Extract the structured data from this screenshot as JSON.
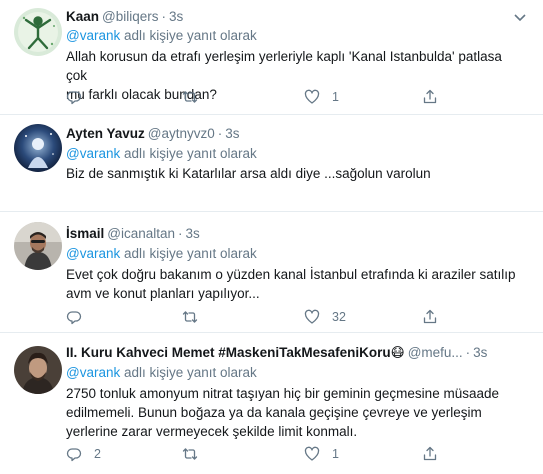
{
  "tweets": [
    {
      "name": "Kaan",
      "handle": "@biliqers",
      "dot": "·",
      "time": "3s",
      "reply_prefix": "",
      "reply_mention": "@varank",
      "reply_suffix": "adlı kişiye yanıt olarak",
      "lines": [
        "Allah korusun da etrafı yerleşim yerleriyle kaplı 'Kanal Istanbulda' patlasa çok",
        "mu farklı olacak bundan?"
      ],
      "counts": {
        "reply": "",
        "retweet": "",
        "like": "1"
      }
    },
    {
      "name": "Ayten Yavuz",
      "handle": "@aytnyvz0",
      "dot": "·",
      "time": "3s",
      "reply_prefix": "",
      "reply_mention": "@varank",
      "reply_suffix": "adlı kişiye yanıt olarak",
      "lines": [
        "Biz de sanmıştık ki Katarlılar arsa aldı diye ...sağolun varolun"
      ],
      "counts": {
        "reply": "",
        "retweet": "",
        "like": ""
      }
    },
    {
      "name": "İsmail",
      "handle": "@icanaltan",
      "dot": "·",
      "time": "3s",
      "reply_prefix": "",
      "reply_mention": "@varank",
      "reply_suffix": "adlı kişiye yanıt olarak",
      "lines": [
        "Evet çok doğru bakanım o yüzden kanal İstanbul etrafında ki araziler satılıp",
        "avm ve konut planları yapılıyor..."
      ],
      "counts": {
        "reply": "",
        "retweet": "",
        "like": "32"
      }
    },
    {
      "name": "II. Kuru Kahveci Memet #MaskeniTakMesafeniKoru",
      "name_emoji": "😷",
      "handle": "@mefu...",
      "dot": "·",
      "time": "3s",
      "reply_prefix": "",
      "reply_mention": "@varank",
      "reply_suffix": "adlı kişiye yanıt olarak",
      "lines": [
        "2750 tonluk amonyum nitrat taşıyan hiç bir geminin geçmesine müsaade",
        "edilmemeli. Bunun boğaza ya da kanala geçişine çevreye ve yerleşim",
        "yerlerine zarar vermeyecek şekilde limit konmalı."
      ],
      "counts": {
        "reply": "2",
        "retweet": "",
        "like": "1"
      }
    }
  ],
  "colors": {
    "link": "#1b95e0",
    "muted": "#657786",
    "text": "#14171a",
    "border": "#e6ecf0"
  },
  "icons": [
    "chevron-down-icon",
    "reply-icon",
    "retweet-icon",
    "like-icon",
    "share-icon",
    "mask-emoji-icon"
  ]
}
